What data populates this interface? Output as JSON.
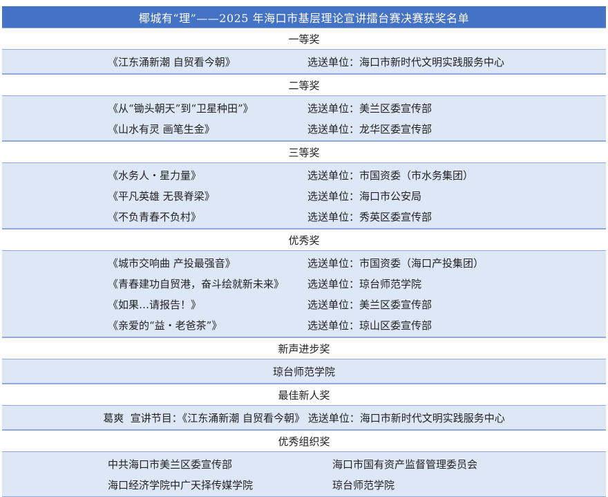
{
  "title": "椰城有“理”——2025 年海口市基层理论宣讲擂台赛决赛获奖名单",
  "first": {
    "heading": "一等奖",
    "rows": [
      {
        "work": "《江东涌新潮 自贸看今朝》",
        "unit": "选送单位：海口市新时代文明实践服务中心"
      }
    ]
  },
  "second": {
    "heading": "二等奖",
    "rows": [
      {
        "work": "《从“锄头朝天”到“卫星种田”》",
        "unit": "选送单位：美兰区委宣传部"
      },
      {
        "work": "《山水有灵 画笔生金》",
        "unit": "选送单位：龙华区委宣传部"
      }
    ]
  },
  "third": {
    "heading": "三等奖",
    "rows": [
      {
        "work": "《水务人・星力量》",
        "unit": "选送单位：市国资委（市水务集团）"
      },
      {
        "work": "《平凡英雄 无畏脊梁》",
        "unit": "选送单位：海口市公安局"
      },
      {
        "work": "《不负青春不负村》",
        "unit": "选送单位：秀英区委宣传部"
      }
    ]
  },
  "excellent": {
    "heading": "优秀奖",
    "rows": [
      {
        "work": "《城市交响曲 产投最强音》",
        "unit": "选送单位：市国资委（海口产投集团）"
      },
      {
        "work": "《青春建功自贸港，奋斗绘就新未来》",
        "unit": "选送单位：琼台师范学院"
      },
      {
        "work": "《如果…请报告！》",
        "unit": "选送单位：美兰区委宣传部"
      },
      {
        "work": "《亲爱的“益・老爸茶”》",
        "unit": "选送单位：琼山区委宣传部"
      }
    ]
  },
  "progress": {
    "heading": "新声进步奖",
    "winner": "琼台师范学院"
  },
  "newcomer": {
    "heading": "最佳新人奖",
    "winner": "葛爽  宣讲节目：《江东涌新潮 自贸看今朝》 选送单位：海口市新时代文明实践服务中心"
  },
  "organization": {
    "heading": "优秀组织奖",
    "rows": [
      {
        "left": "中共海口市美兰区委宣传部",
        "right": "海口市国有资产监督管理委员会"
      },
      {
        "left": "海口经济学院中广天择传媒学院",
        "right": "琼台师范学院"
      }
    ]
  },
  "colors": {
    "header_blue": "#4472c4",
    "band_fill": "#dde7f5",
    "rule": "#8eaadb"
  }
}
